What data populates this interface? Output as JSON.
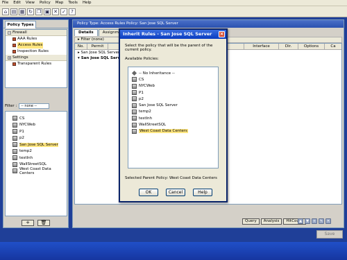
{
  "menubar": {
    "items": [
      "File",
      "Edit",
      "View",
      "Policy",
      "Map",
      "Tools",
      "Help"
    ]
  },
  "toolbar": {
    "icons": [
      "home-icon",
      "print-icon",
      "grid-icon",
      "sync-icon",
      "copy-icon",
      "paste-icon",
      "delete-icon",
      "apply-icon",
      "help-icon"
    ]
  },
  "left": {
    "tab_label": "Policy Types",
    "policy_types": [
      {
        "label": "Firewall",
        "kind": "group"
      },
      {
        "label": "AAA Rules",
        "kind": "child"
      },
      {
        "label": "Access Rules",
        "kind": "child",
        "selected": true
      },
      {
        "label": "Inspection Rules",
        "kind": "child"
      },
      {
        "label": "Settings",
        "kind": "group"
      },
      {
        "label": "Transparent Rules",
        "kind": "child"
      }
    ],
    "filter_label": "Filter :",
    "filter_value": "-- none --",
    "policies": [
      "CS",
      "NYCWeb",
      "P1",
      "p2",
      "San Jose SQL Server",
      "temp2",
      "testInh",
      "WallStreetSQL",
      "West Coast Data Centers"
    ],
    "selected_policy": "San Jose SQL Server",
    "add_glyph": "+",
    "delete_glyph": "🗑"
  },
  "right": {
    "header": "Policy Type: Access Rules    Policy: San Jose SQL Server",
    "tabs": [
      "Details",
      "Assignments"
    ],
    "filter_text": "Filter (none)",
    "columns": [
      "No.",
      "Permit",
      "Interface",
      "Dir.",
      "Options",
      "Ca"
    ],
    "rows": [
      "San Jose SQL Server - M",
      "San Jose SQL Server"
    ],
    "buttons": [
      "Query",
      "Analysis",
      "HitCount"
    ],
    "save_label": "Save"
  },
  "dialog": {
    "title": "Inherit Rules - San Jose SQL Server",
    "instruction": "Select the policy that will be the parent of the current policy.",
    "available_label": "Available Policies:",
    "no_inheritance": "-- No Inheritance --",
    "policies": [
      "CS",
      "NYCWeb",
      "P1",
      "p2",
      "San Jose SQL Server",
      "temp2",
      "testInh",
      "WallStreetSQL",
      "West Coast Data Centers"
    ],
    "selected": "West Coast Data Centers",
    "parent_label": "Selected Parent Policy: West Coast Data Centers",
    "ok_label": "OK",
    "cancel_label": "Cancel",
    "help_label": "Help",
    "close_glyph": "×"
  },
  "colors": {
    "titlebar": "#0a3cc0",
    "highlight": "#ffe680",
    "desktop": "#1f3f98"
  }
}
